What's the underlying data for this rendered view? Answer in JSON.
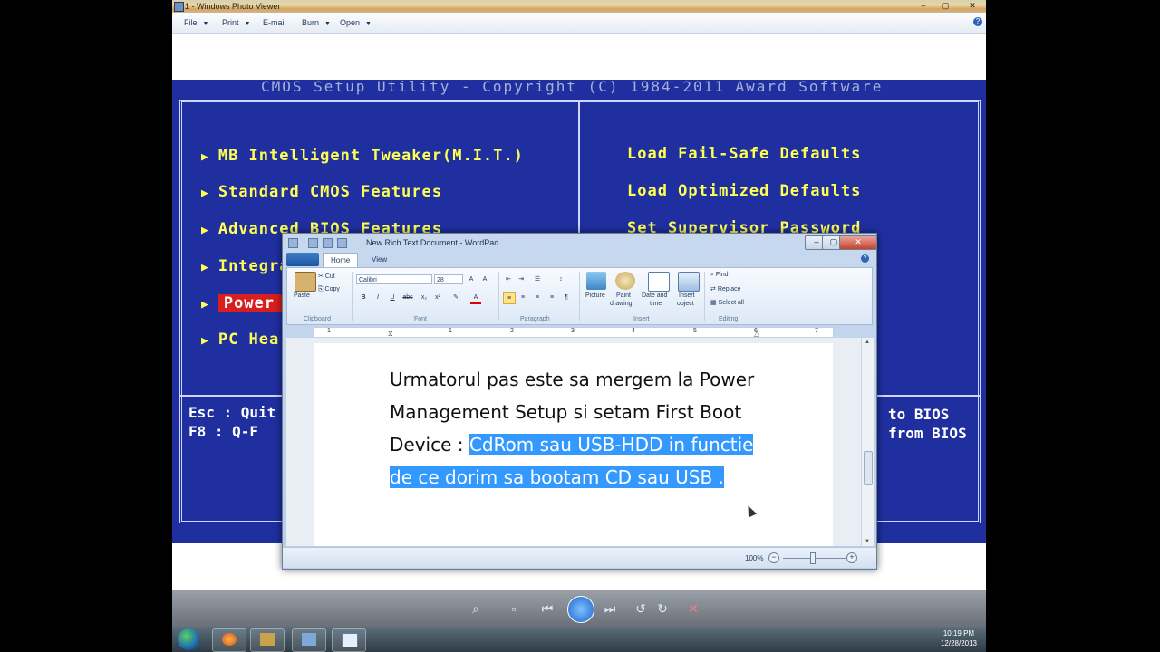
{
  "photo_viewer": {
    "title": "1 - Windows Photo Viewer",
    "menu": [
      "File",
      "Print",
      "E-mail",
      "Burn",
      "Open"
    ],
    "window_controls": [
      "–",
      "▢",
      "✕"
    ],
    "help": "?"
  },
  "bios": {
    "title": "CMOS Setup Utility - Copyright (C) 1984-2011 Award Software",
    "left_items": [
      "MB Intelligent Tweaker(M.I.T.)",
      "Standard CMOS Features",
      "Advanced BIOS Features",
      "Integra",
      "Power M",
      "PC Hea"
    ],
    "selected_item": "Power M",
    "right_items": [
      "Load Fail-Safe Defaults",
      "Load Optimized Defaults",
      "Set Supervisor Password"
    ],
    "footer_left": [
      "Esc : Quit",
      "F8  : Q-F"
    ],
    "footer_right": [
      "to BIOS",
      "from BIOS"
    ],
    "colors": {
      "background": "#1f2f9f",
      "text": "#ffff54",
      "selected": "#d81e1e"
    }
  },
  "wordpad": {
    "title": "New Rich Text Document - WordPad",
    "tabs": [
      "Home",
      "View"
    ],
    "active_tab": "Home",
    "clipboard": {
      "paste": "Paste",
      "cut": "Cut",
      "copy": "Copy",
      "label": "Clipboard"
    },
    "font": {
      "family": "Calibri",
      "size": "28",
      "label": "Font",
      "buttons": [
        "B",
        "I",
        "U",
        "abc",
        "x₂",
        "x²"
      ]
    },
    "paragraph": {
      "label": "Paragraph"
    },
    "insert": {
      "picture": "Picture",
      "paint_line1": "Paint",
      "paint_line2": "drawing",
      "datetime_line1": "Date and",
      "datetime_line2": "time",
      "object_line1": "Insert",
      "object_line2": "object",
      "label": "Insert"
    },
    "editing": {
      "find": "Find",
      "replace": "Replace",
      "select_all": "Select all",
      "label": "Editing"
    },
    "ruler_numbers": [
      "1",
      "1",
      "2",
      "3",
      "4",
      "5",
      "6",
      "7"
    ],
    "document": {
      "plain": "Urmatorul pas este sa mergem la Power Management Setup si setam First Boot Device : ",
      "selected": "CdRom sau USB-HDD in functie de ce dorim sa bootam CD sau USB ."
    },
    "zoom": "100%"
  },
  "photo_viewer_bottom": {
    "buttons": [
      "zoom-icon",
      "actual-size-icon",
      "previous-icon",
      "slideshow-icon",
      "next-icon",
      "rotate-ccw-icon",
      "rotate-cw-icon",
      "delete-icon"
    ]
  },
  "taskbar": {
    "time": "10:19 PM",
    "date": "12/28/2013"
  }
}
